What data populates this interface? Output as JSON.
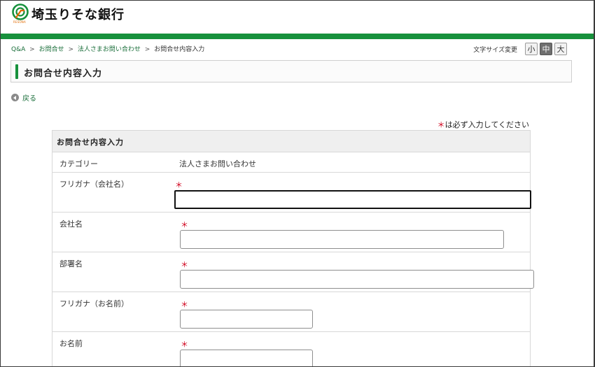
{
  "header": {
    "bank_name": "埼玉りそな銀行",
    "brand_sub": "RESONA",
    "colors": {
      "brand_green": "#17913c",
      "brand_orange": "#e06a00",
      "required": "#d0001b"
    }
  },
  "breadcrumb": {
    "items": [
      "Q&A",
      "お問合せ",
      "法人さまお問い合わせ",
      "お問合せ内容入力"
    ],
    "separator": ">"
  },
  "font_size": {
    "label": "文字サイズ変更",
    "options": [
      "小",
      "中",
      "大"
    ],
    "selected": "中"
  },
  "page_title": "お問合せ内容入力",
  "back_label": "戻る",
  "required_note": {
    "star": "＊",
    "text": "は必ず入力してください"
  },
  "form": {
    "heading": "お問合せ内容入力",
    "required_star": "＊",
    "category": {
      "label": "カテゴリー",
      "value": "法人さまお問い合わせ"
    },
    "fields": [
      {
        "label": "フリガナ（会社名）",
        "value": ""
      },
      {
        "label": "会社名",
        "value": ""
      },
      {
        "label": "部署名",
        "value": ""
      },
      {
        "label": "フリガナ（お名前）",
        "value": ""
      },
      {
        "label": "お名前",
        "value": ""
      }
    ]
  }
}
